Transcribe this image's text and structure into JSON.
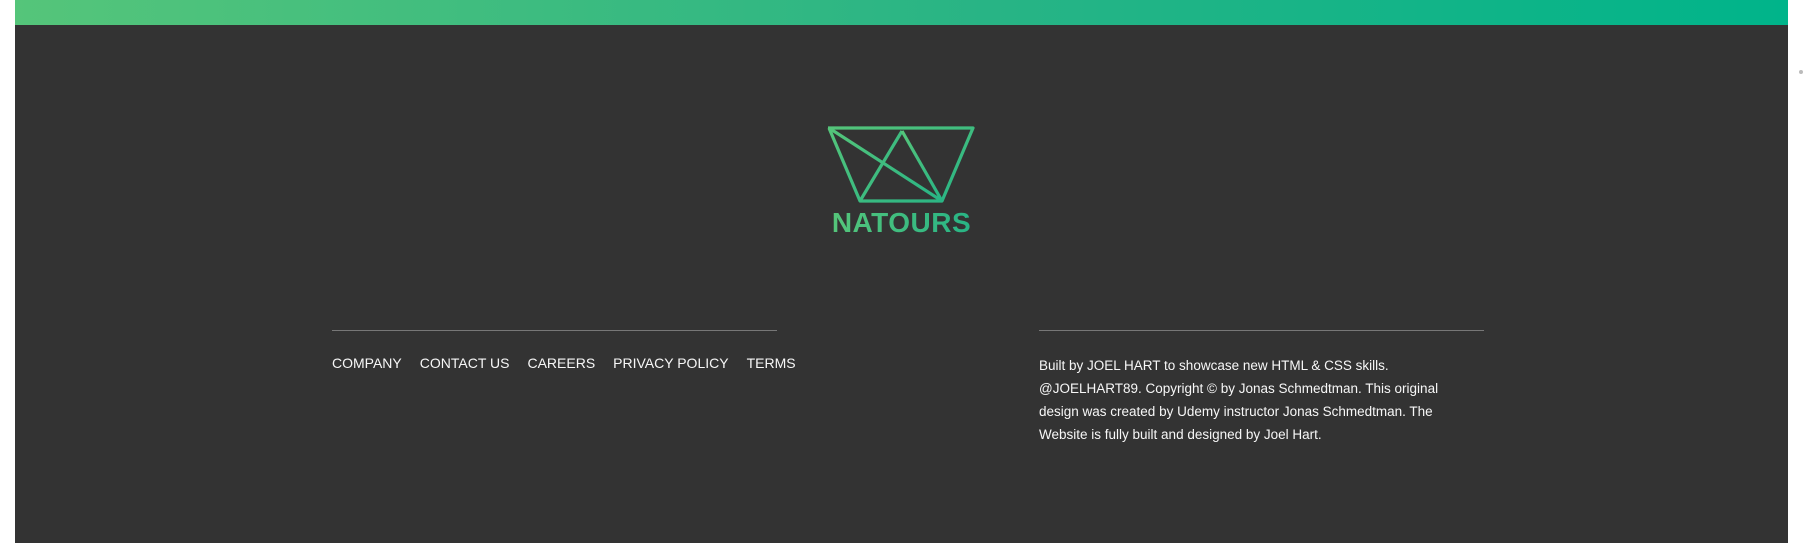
{
  "colors": {
    "accent_light": "#55c57a",
    "accent_dark": "#28b485",
    "footer_bg": "#333333",
    "text": "#f7f7f7"
  },
  "logo": {
    "icon": "crown-icon",
    "text": "NATOURS"
  },
  "nav": {
    "items": [
      {
        "label": "COMPANY"
      },
      {
        "label": "CONTACT US"
      },
      {
        "label": "CAREERS"
      },
      {
        "label": "PRIVACY POLICY"
      },
      {
        "label": "TERMS"
      }
    ]
  },
  "copyright": {
    "text": "Built by JOEL HART to showcase new HTML & CSS skills. @JOELHART89. Copyright © by Jonas Schmedtman. This original design was created by Udemy instructor Jonas Schmedtman. The Website is fully built and designed by Joel Hart."
  }
}
